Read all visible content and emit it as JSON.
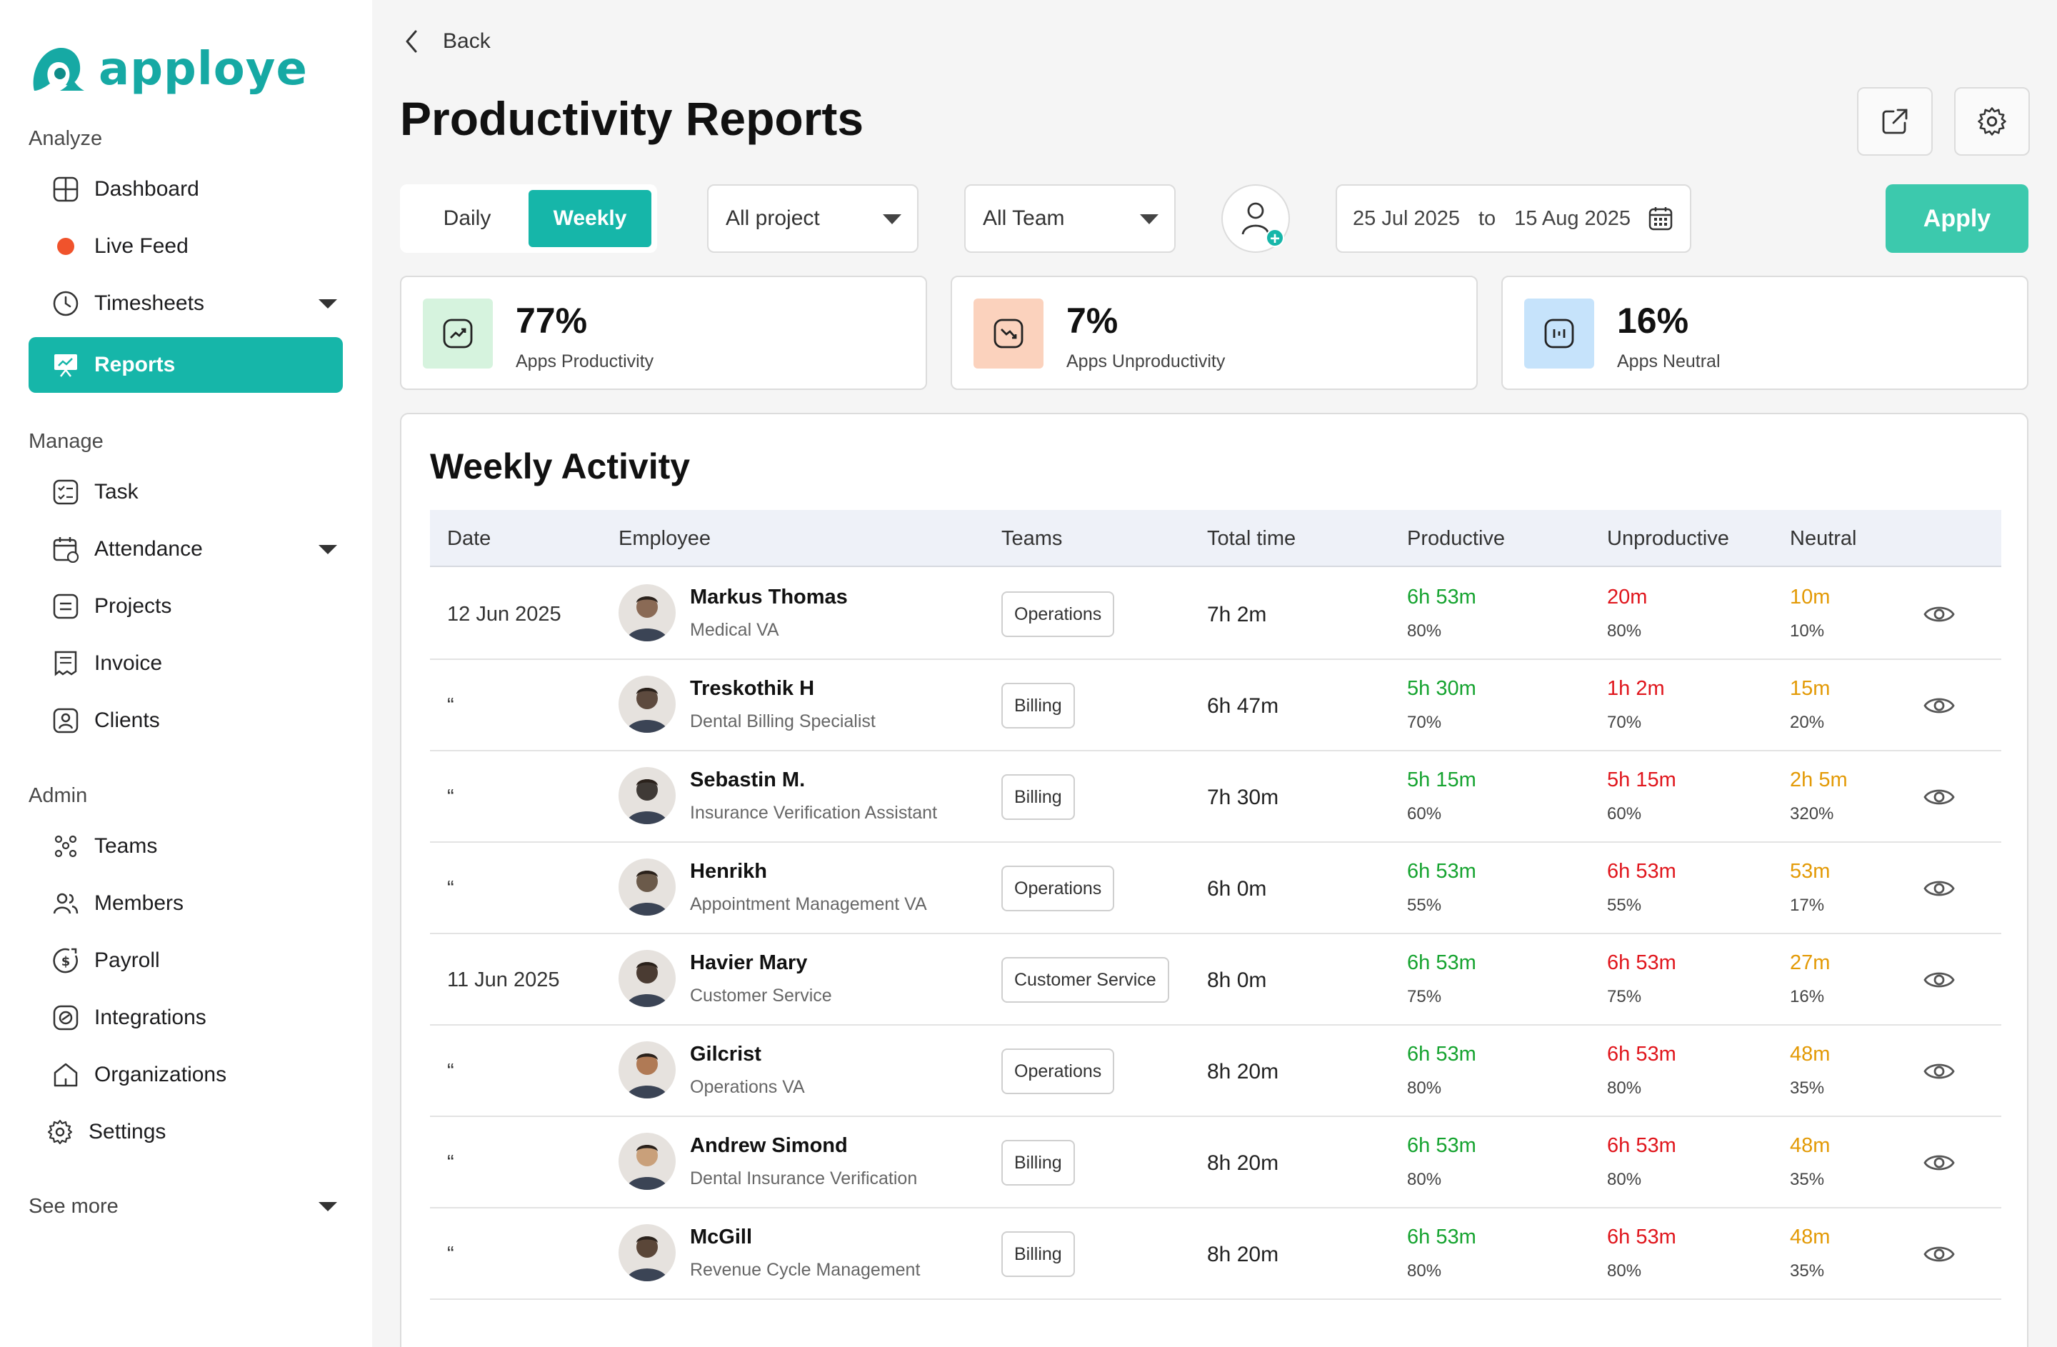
{
  "brand": {
    "name": "apploye",
    "color": "#16a9a4"
  },
  "sidebar": {
    "sections": {
      "analyze": "Analyze",
      "manage": "Manage",
      "admin": "Admin"
    },
    "analyze_items": [
      {
        "label": "Dashboard",
        "icon": "dashboard-icon"
      },
      {
        "label": "Live Feed",
        "icon": "live-dot-icon"
      },
      {
        "label": "Timesheets",
        "icon": "clock-icon"
      },
      {
        "label": "Reports",
        "icon": "presentation-chart-icon",
        "active": true
      }
    ],
    "manage_items": [
      {
        "label": "Task",
        "icon": "task-list-icon"
      },
      {
        "label": "Attendance",
        "icon": "calendar-check-icon"
      },
      {
        "label": "Projects",
        "icon": "projects-icon"
      },
      {
        "label": "Invoice",
        "icon": "invoice-icon"
      },
      {
        "label": "Clients",
        "icon": "client-icon"
      }
    ],
    "admin_items": [
      {
        "label": "Teams",
        "icon": "teams-icon"
      },
      {
        "label": "Members",
        "icon": "members-icon"
      },
      {
        "label": "Payroll",
        "icon": "payroll-icon"
      },
      {
        "label": "Integrations",
        "icon": "integrations-icon"
      },
      {
        "label": "Organizations",
        "icon": "organizations-icon"
      },
      {
        "label": "Settings",
        "icon": "gear-icon"
      }
    ],
    "see_more": "See more"
  },
  "header": {
    "back_label": "Back",
    "title": "Productivity Reports"
  },
  "filters": {
    "period_options": [
      "Daily",
      "Weekly"
    ],
    "period_selected": "Weekly",
    "project": "All project",
    "team": "All Team",
    "date_from": "25 Jul 2025",
    "date_to_word": "to",
    "date_to": "15 Aug 2025",
    "apply_label": "Apply"
  },
  "stats": [
    {
      "value": "77%",
      "label": "Apps Productivity",
      "color": "#d6f3de"
    },
    {
      "value": "7%",
      "label": "Apps Unproductivity",
      "color": "#fbd2bd"
    },
    {
      "value": "16%",
      "label": "Apps Neutral",
      "color": "#c6e3fb"
    }
  ],
  "table": {
    "title": "Weekly Activity",
    "columns": [
      "Date",
      "Employee",
      "Teams",
      "Total time",
      "Productive",
      "Unproductive",
      "Neutral"
    ],
    "rows": [
      {
        "date": "12 Jun 2025",
        "name": "Markus Thomas",
        "role": "Medical VA",
        "team": "Operations",
        "total": "7h 2m",
        "productive": "6h 53m",
        "productive_pct": "80%",
        "unproductive": "20m",
        "unproductive_pct": "80%",
        "neutral": "10m",
        "neutral_pct": "10%"
      },
      {
        "date": "“",
        "name": "Treskothik H",
        "role": "Dental Billing Specialist",
        "team": "Billing",
        "total": "6h 47m",
        "productive": "5h 30m",
        "productive_pct": "70%",
        "unproductive": "1h 2m",
        "unproductive_pct": "70%",
        "neutral": "15m",
        "neutral_pct": "20%"
      },
      {
        "date": "“",
        "name": "Sebastin M.",
        "role": "Insurance Verification Assistant",
        "team": "Billing",
        "total": "7h 30m",
        "productive": "5h 15m",
        "productive_pct": "60%",
        "unproductive": "5h 15m",
        "unproductive_pct": "60%",
        "neutral": "2h 5m",
        "neutral_pct": "320%"
      },
      {
        "date": "“",
        "name": "Henrikh",
        "role": "Appointment Management VA",
        "team": "Operations",
        "total": "6h 0m",
        "productive": "6h 53m",
        "productive_pct": "55%",
        "unproductive": "6h 53m",
        "unproductive_pct": "55%",
        "neutral": "53m",
        "neutral_pct": "17%"
      },
      {
        "date": "11 Jun 2025",
        "name": "Havier Mary",
        "role": "Customer Service",
        "team": "Customer Service",
        "total": "8h 0m",
        "productive": "6h 53m",
        "productive_pct": "75%",
        "unproductive": "6h 53m",
        "unproductive_pct": "75%",
        "neutral": "27m",
        "neutral_pct": "16%"
      },
      {
        "date": "“",
        "name": "Gilcrist",
        "role": "Operations VA",
        "team": "Operations",
        "total": "8h 20m",
        "productive": "6h 53m",
        "productive_pct": "80%",
        "unproductive": "6h 53m",
        "unproductive_pct": "80%",
        "neutral": "48m",
        "neutral_pct": "35%"
      },
      {
        "date": "“",
        "name": "Andrew Simond",
        "role": "Dental Insurance Verification",
        "team": "Billing",
        "total": "8h 20m",
        "productive": "6h 53m",
        "productive_pct": "80%",
        "unproductive": "6h 53m",
        "unproductive_pct": "80%",
        "neutral": "48m",
        "neutral_pct": "35%"
      },
      {
        "date": "“",
        "name": "McGill",
        "role": "Revenue Cycle Management",
        "team": "Billing",
        "total": "8h 20m",
        "productive": "6h 53m",
        "productive_pct": "80%",
        "unproductive": "6h 53m",
        "unproductive_pct": "80%",
        "neutral": "48m",
        "neutral_pct": "35%"
      }
    ]
  },
  "colors": {
    "accent": "#16b6a9",
    "apply": "#3cc9ad",
    "productive": "#15a32f",
    "unproductive": "#e0151c",
    "neutral": "#e39a06"
  }
}
